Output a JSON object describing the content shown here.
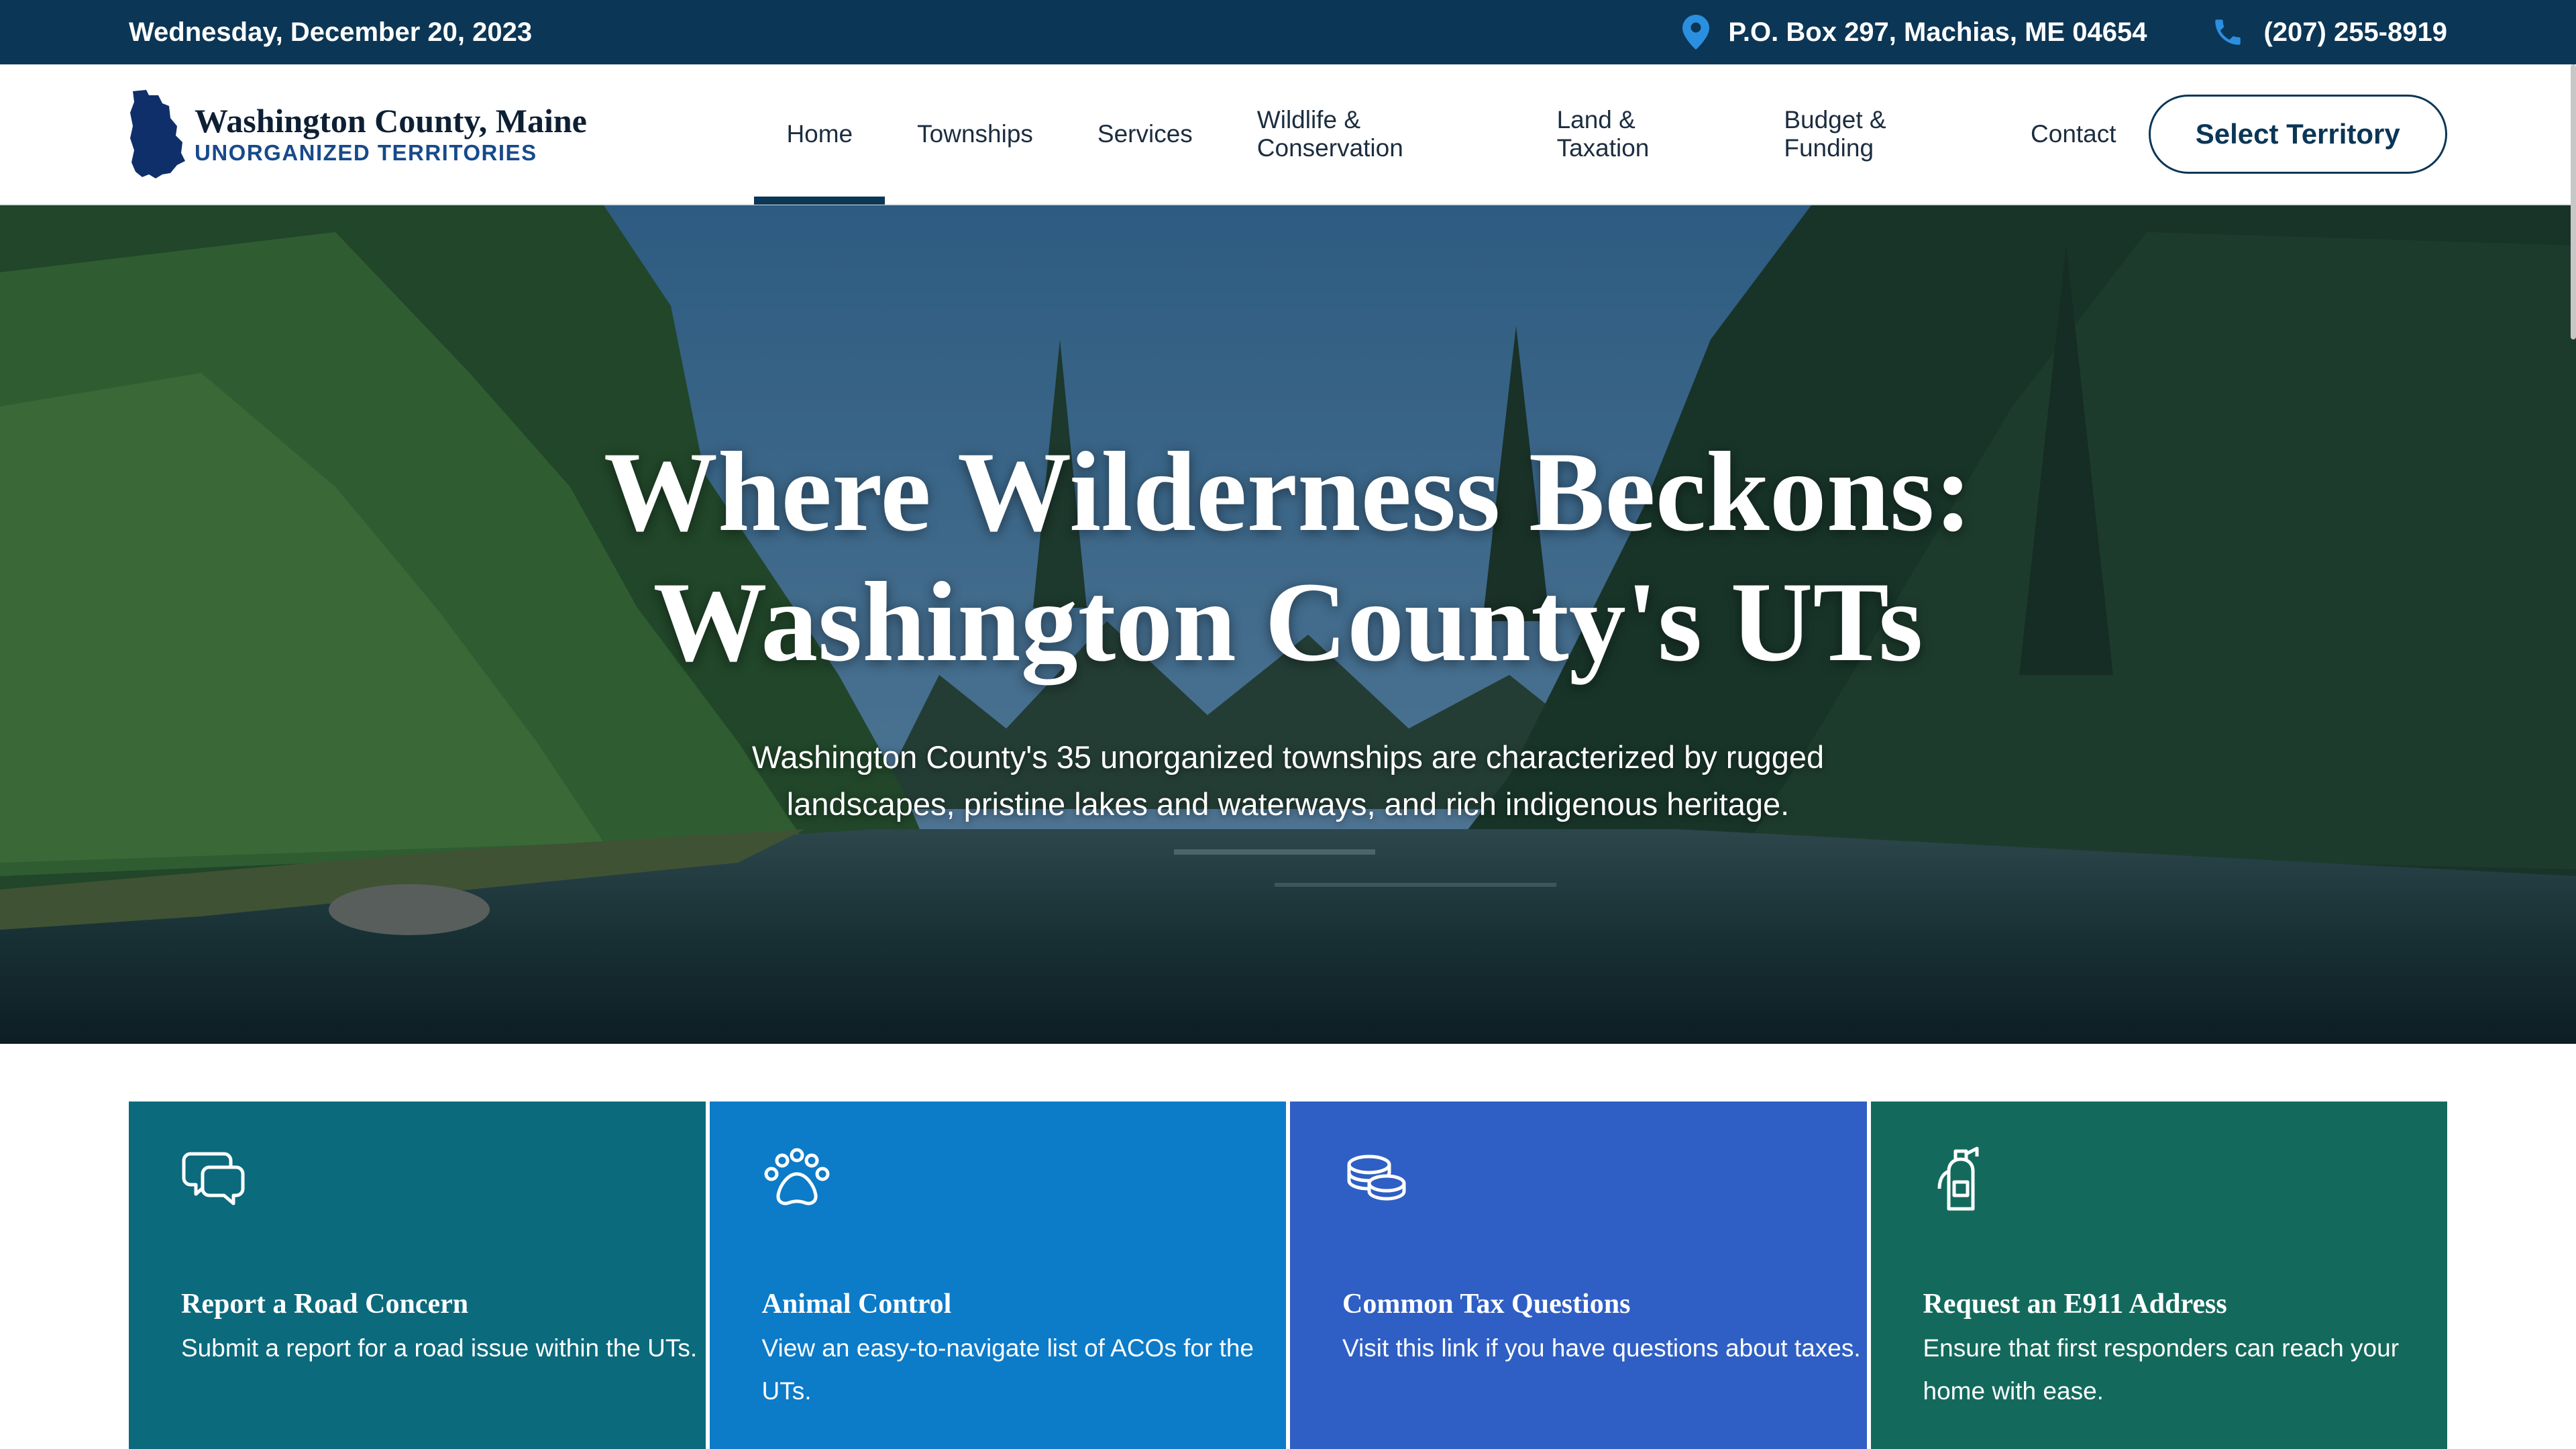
{
  "topbar": {
    "date": "Wednesday, December 20, 2023",
    "address": "P.O. Box 297, Machias, ME 04654",
    "phone": "(207) 255-8919"
  },
  "header": {
    "logo_name": "Washington County, Maine",
    "logo_sub": "UNORGANIZED TERRITORIES",
    "nav": [
      "Home",
      "Townships",
      "Services",
      "Wildlife & Conservation",
      "Land & Taxation",
      "Budget & Funding",
      "Contact"
    ],
    "active_nav": "Home",
    "cta": "Select Territory"
  },
  "hero": {
    "title_line1": "Where Wilderness Beckons:",
    "title_line2": "Washington County's UTs",
    "subtitle": "Washington County's 35 unorganized townships are characterized by rugged landscapes, pristine lakes and waterways, and rich indigenous heritage."
  },
  "cards": [
    {
      "icon": "speech-bubbles-icon",
      "title": "Report a Road Concern",
      "desc": "Submit a report for a road issue within the UTs.",
      "color": "#0b6a7c"
    },
    {
      "icon": "paw-icon",
      "title": "Animal Control",
      "desc": "View an easy-to-navigate list of ACOs for the UTs.",
      "color": "#0c7bc8"
    },
    {
      "icon": "coins-icon",
      "title": "Common Tax Questions",
      "desc": "Visit this link if you have questions about taxes.",
      "color": "#2f5fc4"
    },
    {
      "icon": "fire-extinguisher-icon",
      "title": "Request an E911 Address",
      "desc": "Ensure that first responders can reach your home with ease.",
      "color": "#136a5c"
    }
  ],
  "colors": {
    "navy": "#0b3656",
    "accent_blue": "#2b8fe0"
  }
}
